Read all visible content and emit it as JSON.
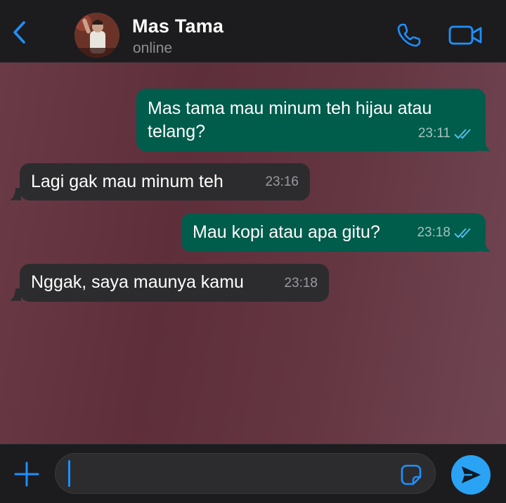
{
  "header": {
    "contact_name": "Mas Tama",
    "status": "online",
    "accent_color": "#1e90ff"
  },
  "messages": [
    {
      "direction": "outgoing",
      "text_line1": "Mas tama mau minum teh hijau atau",
      "text_line2": "telang?",
      "time": "23:11",
      "read": true
    },
    {
      "direction": "incoming",
      "text": "Lagi gak mau minum teh",
      "time": "23:16"
    },
    {
      "direction": "outgoing",
      "text": "Mau kopi atau apa gitu?",
      "time": "23:18",
      "read": true
    },
    {
      "direction": "incoming",
      "text": "Nggak, saya maunya kamu",
      "time": "23:18"
    }
  ],
  "composer": {
    "value": "",
    "placeholder": ""
  },
  "icons": {
    "back": "chevron-left-icon",
    "call": "phone-icon",
    "video": "video-camera-icon",
    "attach": "plus-icon",
    "sticker": "sticker-icon",
    "send": "send-icon",
    "read_receipt": "double-check-icon"
  },
  "colors": {
    "outgoing_bubble": "#005c4b",
    "incoming_bubble": "#2c2c2e",
    "read_check": "#53bdeb",
    "send_button": "#2aa3f5"
  }
}
